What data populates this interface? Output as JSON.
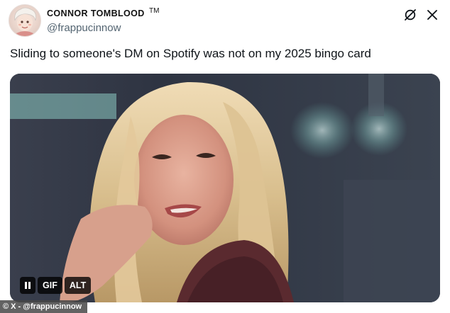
{
  "author": {
    "display_name": "CONNOR TOMBLOOD",
    "trademark": "TM",
    "handle": "@frappucinnow",
    "avatar_icon": "cartoon-avatar-icon"
  },
  "header_icons": [
    "grok-icon",
    "more-icon"
  ],
  "tweet": {
    "text": "Sliding to someone's DM on Spotify was not on my 2025 bingo card"
  },
  "media": {
    "type": "gif",
    "gif_label": "GIF",
    "alt_label": "ALT",
    "pause_icon": "pause-icon"
  },
  "watermark": "© X - @frappucinnow"
}
